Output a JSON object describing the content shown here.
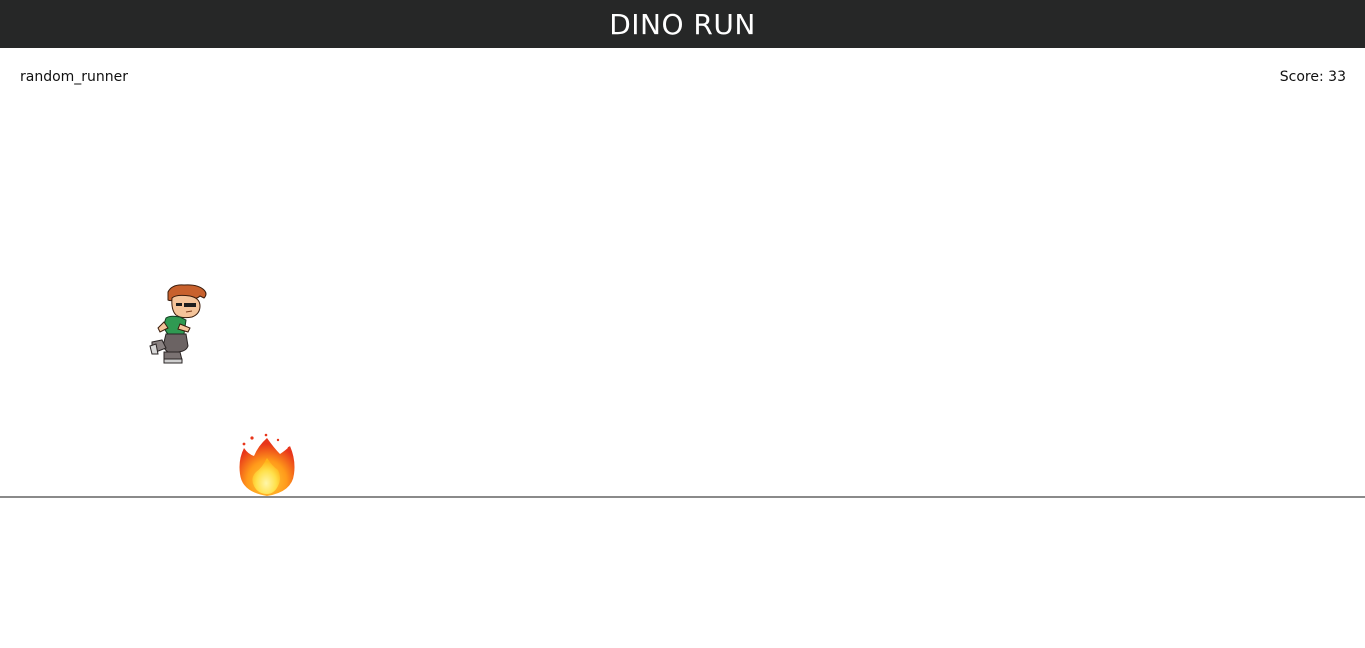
{
  "header": {
    "title": "DINO RUN"
  },
  "hud": {
    "player_name": "random_runner",
    "score_label": "Score:",
    "score_value": "33"
  },
  "scene": {
    "player_icon": "runner-character-icon",
    "obstacle_icon": "fire-icon",
    "colors": {
      "header_bg": "#262727",
      "header_text": "#ffffff",
      "ground": "#8a8a8a",
      "background": "#ffffff"
    }
  }
}
